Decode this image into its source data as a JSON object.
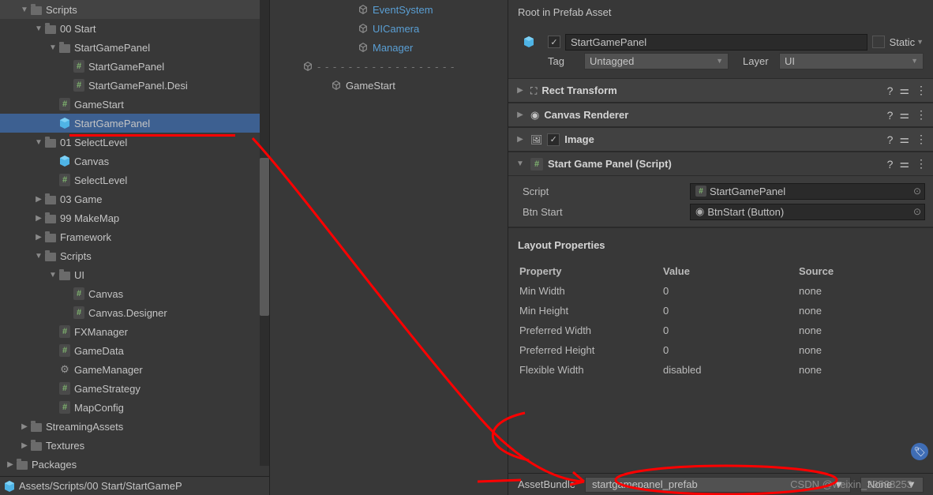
{
  "project": {
    "tree": [
      {
        "depth": 1,
        "arrow": "down",
        "icon": "folder",
        "label": "Scripts"
      },
      {
        "depth": 2,
        "arrow": "down",
        "icon": "folder",
        "label": "00 Start"
      },
      {
        "depth": 3,
        "arrow": "down",
        "icon": "folder",
        "label": "StartGamePanel"
      },
      {
        "depth": 4,
        "arrow": "none",
        "icon": "cs",
        "label": "StartGamePanel"
      },
      {
        "depth": 4,
        "arrow": "none",
        "icon": "cs",
        "label": "StartGamePanel.Desi"
      },
      {
        "depth": 3,
        "arrow": "none",
        "icon": "cs",
        "label": "GameStart"
      },
      {
        "depth": 3,
        "arrow": "none",
        "icon": "prefab",
        "label": "StartGamePanel",
        "selected": true
      },
      {
        "depth": 2,
        "arrow": "down",
        "icon": "folder",
        "label": "01 SelectLevel"
      },
      {
        "depth": 3,
        "arrow": "none",
        "icon": "prefab",
        "label": "Canvas"
      },
      {
        "depth": 3,
        "arrow": "none",
        "icon": "cs",
        "label": "SelectLevel"
      },
      {
        "depth": 2,
        "arrow": "right",
        "icon": "folder",
        "label": "03 Game"
      },
      {
        "depth": 2,
        "arrow": "right",
        "icon": "folder",
        "label": "99 MakeMap"
      },
      {
        "depth": 2,
        "arrow": "right",
        "icon": "folder",
        "label": "Framework"
      },
      {
        "depth": 2,
        "arrow": "down",
        "icon": "folder",
        "label": "Scripts"
      },
      {
        "depth": 3,
        "arrow": "down",
        "icon": "folder",
        "label": "UI"
      },
      {
        "depth": 4,
        "arrow": "none",
        "icon": "cs",
        "label": "Canvas"
      },
      {
        "depth": 4,
        "arrow": "none",
        "icon": "cs",
        "label": "Canvas.Designer"
      },
      {
        "depth": 3,
        "arrow": "none",
        "icon": "cs",
        "label": "FXManager"
      },
      {
        "depth": 3,
        "arrow": "none",
        "icon": "cs",
        "label": "GameData"
      },
      {
        "depth": 3,
        "arrow": "none",
        "icon": "gear",
        "label": "GameManager"
      },
      {
        "depth": 3,
        "arrow": "none",
        "icon": "cs",
        "label": "GameStrategy"
      },
      {
        "depth": 3,
        "arrow": "none",
        "icon": "cs",
        "label": "MapConfig"
      },
      {
        "depth": 1,
        "arrow": "right",
        "icon": "folder",
        "label": "StreamingAssets"
      },
      {
        "depth": 1,
        "arrow": "right",
        "icon": "folder",
        "label": "Textures"
      },
      {
        "depth": 0,
        "arrow": "right",
        "icon": "folder",
        "label": "Packages"
      }
    ],
    "path": "Assets/Scripts/00 Start/StartGameP"
  },
  "hierarchy": {
    "items": [
      {
        "depth": 2,
        "arrow": "none",
        "icon": "go",
        "label": "EventSystem",
        "blue": true
      },
      {
        "depth": 2,
        "arrow": "none",
        "icon": "go",
        "label": "UICamera",
        "blue": true
      },
      {
        "depth": 2,
        "arrow": "none",
        "icon": "go",
        "label": "Manager",
        "blue": true
      }
    ],
    "sep_dashes": "- - - - - - - - - - - - - - - - - -",
    "bottom": {
      "depth": 2,
      "arrow": "none",
      "icon": "go",
      "label": "GameStart"
    }
  },
  "inspector": {
    "title": "Root in Prefab Asset",
    "name": "StartGamePanel",
    "static": "Static",
    "tag_label": "Tag",
    "tag_value": "Untagged",
    "layer_label": "Layer",
    "layer_value": "UI",
    "components": [
      {
        "title": "Rect Transform",
        "icon": "rect",
        "open": false,
        "chk": false
      },
      {
        "title": "Canvas Renderer",
        "icon": "eye",
        "open": false,
        "chk": false
      },
      {
        "title": "Image",
        "icon": "img",
        "open": false,
        "chk": true
      },
      {
        "title": "Start Game Panel (Script)",
        "icon": "cs",
        "open": true,
        "chk": false,
        "rows": [
          {
            "label": "Script",
            "value": "StartGamePanel",
            "icon": "cs"
          },
          {
            "label": "Btn Start",
            "value": "BtnStart (Button)",
            "icon": "dot"
          }
        ]
      }
    ],
    "layout": {
      "title": "Layout Properties",
      "headers": {
        "property": "Property",
        "value": "Value",
        "source": "Source"
      },
      "rows": [
        {
          "p": "Min Width",
          "v": "0",
          "s": "none"
        },
        {
          "p": "Min Height",
          "v": "0",
          "s": "none"
        },
        {
          "p": "Preferred Width",
          "v": "0",
          "s": "none"
        },
        {
          "p": "Preferred Height",
          "v": "0",
          "s": "none"
        },
        {
          "p": "Flexible Width",
          "v": "disabled",
          "s": "none"
        }
      ]
    },
    "assetbundle": {
      "label": "AssetBundle",
      "value": "startgamepanel_prefab",
      "none": "None"
    }
  },
  "watermark": "CSDN @weixin_39538253"
}
